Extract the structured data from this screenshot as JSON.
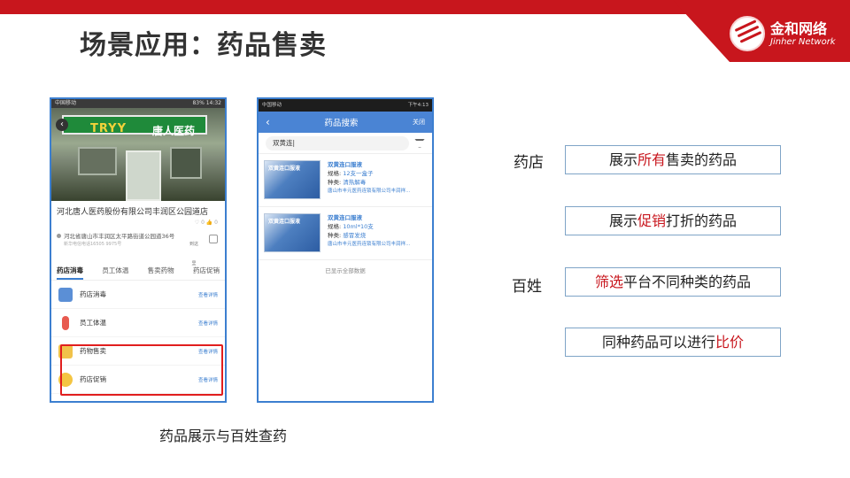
{
  "slide": {
    "title": "场景应用：药品售卖"
  },
  "logo": {
    "cn": "金和网络",
    "en": "Jinher Network"
  },
  "colors": {
    "accent": "#c8161d",
    "phone_border": "#3c7fd0",
    "box_border": "#7fa4c7"
  },
  "phone1": {
    "status_left": "中国移动",
    "status_right": "83% 14:32",
    "sign_en": "TRYY",
    "sign_cn": "唐人医药",
    "store_name": "河北唐人医药股份有限公司丰润区公园道店",
    "likes": "♡ 0   👍 0",
    "address": "河北省唐山市丰润区太平路街道公园道36号",
    "phone": "新华电信电话16505 9975号",
    "nav_label": "到这里",
    "tabs": [
      {
        "label": "药店消毒"
      },
      {
        "label": "员工体温"
      },
      {
        "label": "售卖药物"
      },
      {
        "label": "药店促销"
      }
    ],
    "items": [
      {
        "label": "药店消毒",
        "more": "查看详情"
      },
      {
        "label": "员工体温",
        "more": "查看详情"
      },
      {
        "label": "药物售卖",
        "more": "查看详情"
      },
      {
        "label": "药店促销",
        "more": "查看详情"
      }
    ]
  },
  "phone2": {
    "status_left": "中国移动",
    "status_right": "下午4:13",
    "nav_title": "药品搜索",
    "close_label": "关闭",
    "search_value": "双黄连|",
    "results": [
      {
        "box_text": "双黄连口服液",
        "name": "双黄连口服液",
        "spec_label": "规格:",
        "spec": "12支一盒子",
        "type_label": "种类:",
        "type": "清热解毒",
        "firm": "唐山市丰元医药连锁有限公司丰润祥..."
      },
      {
        "box_text": "双黄连口服液",
        "name": "双黄连口服液",
        "spec_label": "规格:",
        "spec": "10ml*10支",
        "type_label": "种类:",
        "type": "感冒发烧",
        "firm": "唐山市丰元医药连锁有限公司丰润祥..."
      }
    ],
    "end_text": "已显示全部数据"
  },
  "right": {
    "label_store": "药店",
    "label_people": "百姓",
    "box1": {
      "pre": "展示",
      "hl": "所有",
      "post": "售卖的药品"
    },
    "box2": {
      "pre": "展示",
      "hl": "促销",
      "post": "打折的药品"
    },
    "box3": {
      "pre": "",
      "hl": "筛选",
      "post": "平台不同种类的药品"
    },
    "box4": {
      "pre": "同种药品可以进行",
      "hl": "比价",
      "post": ""
    }
  },
  "caption": "药品展示与百姓查药"
}
